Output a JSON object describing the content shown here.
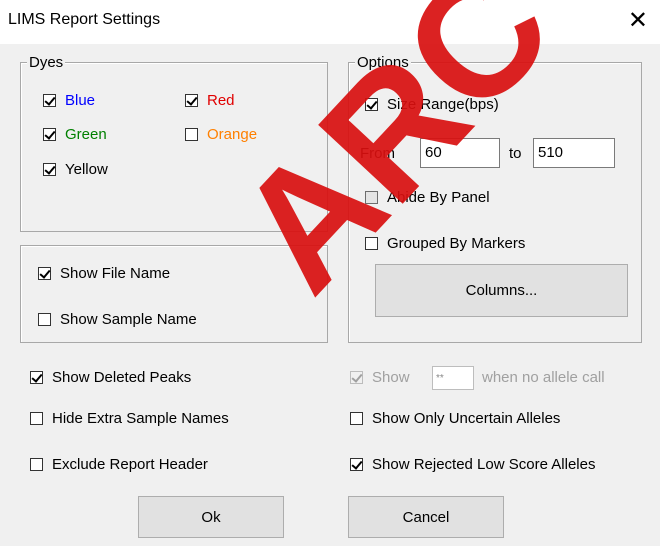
{
  "window": {
    "title": "LIMS Report Settings",
    "close_glyph": "✕"
  },
  "dyes": {
    "legend": "Dyes",
    "items": [
      {
        "label": "Blue",
        "checked": true,
        "color": "#0000ff"
      },
      {
        "label": "Red",
        "checked": true,
        "color": "#e00000"
      },
      {
        "label": "Green",
        "checked": true,
        "color": "#008000"
      },
      {
        "label": "Orange",
        "checked": false,
        "color": "#ff8000"
      },
      {
        "label": "Yellow",
        "checked": true,
        "color": "#000000"
      }
    ]
  },
  "file_options": {
    "show_file_name": {
      "label": "Show File Name",
      "checked": true
    },
    "show_sample_name": {
      "label": "Show Sample Name",
      "checked": false
    }
  },
  "options": {
    "legend": "Options",
    "size_range": {
      "label": "Size Range(bps)",
      "checked": true
    },
    "from_label": "From",
    "from_value": "60",
    "to_label": "to",
    "to_value": "510",
    "abide_by_panel": {
      "label": "Abide By Panel",
      "checked": false
    },
    "grouped_by_markers": {
      "label": "Grouped By Markers",
      "checked": false
    },
    "columns_button": "Columns..."
  },
  "bottom_left": {
    "show_deleted_peaks": {
      "label": "Show Deleted Peaks",
      "checked": true
    },
    "hide_extra_sample_names": {
      "label": "Hide Extra Sample Names",
      "checked": false
    },
    "exclude_report_header": {
      "label": "Exclude Report Header",
      "checked": false
    }
  },
  "bottom_right": {
    "show_label": "Show",
    "no_call_value": "**",
    "no_call_suffix": "when no allele call",
    "show_only_uncertain": {
      "label": "Show Only Uncertain Alleles",
      "checked": false
    },
    "show_rejected_low_score": {
      "label": "Show Rejected Low Score Alleles",
      "checked": true
    }
  },
  "buttons": {
    "ok": "Ok",
    "cancel": "Cancel"
  },
  "watermark": "ARC"
}
